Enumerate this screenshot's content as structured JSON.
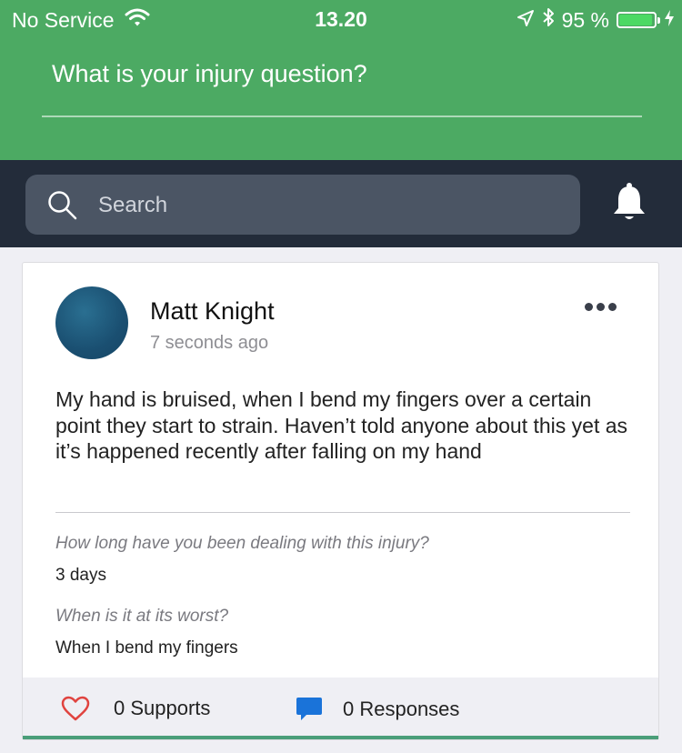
{
  "status_bar": {
    "carrier": "No Service",
    "time": "13.20",
    "battery_percent": "95 %",
    "battery_level": 0.95
  },
  "header": {
    "question_prompt": "What is your injury question?"
  },
  "search": {
    "placeholder": "Search"
  },
  "post": {
    "author": "Matt Knight",
    "timestamp": "7 seconds ago",
    "body": "My hand is bruised, when I bend my fingers over a certain point they start to strain. Haven’t told anyone about this yet as it’s happened recently after falling on my hand",
    "details": [
      {
        "question": "How long have you been dealing with this injury?",
        "answer": "3 days"
      },
      {
        "question": "When is it at its worst?",
        "answer": "When I bend my fingers"
      }
    ],
    "actions": {
      "supports": "0 Supports",
      "responses": "0 Responses"
    }
  },
  "colors": {
    "header_green": "#4caa63",
    "search_bar_bg": "#232c3a",
    "heart_red": "#e0433f",
    "chat_blue": "#1a73d9"
  },
  "icons": [
    "wifi-icon",
    "location-arrow-icon",
    "bluetooth-icon",
    "charging-icon",
    "search-icon",
    "bell-icon",
    "more-options-icon",
    "heart-icon",
    "chat-bubble-icon"
  ]
}
